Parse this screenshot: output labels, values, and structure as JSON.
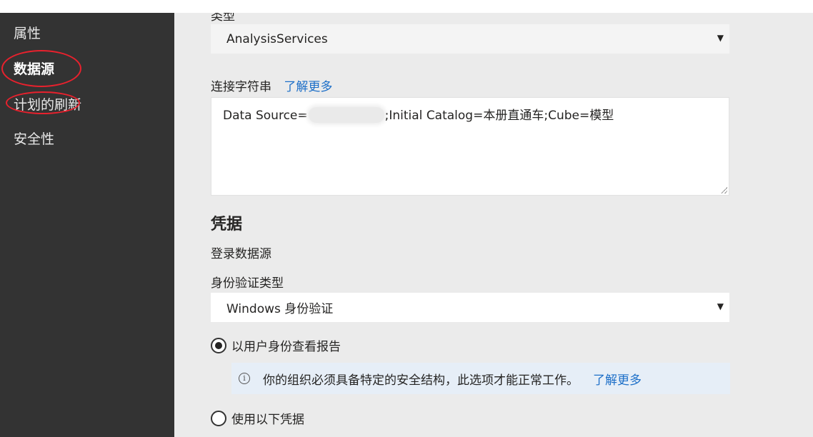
{
  "sidebar": {
    "items": [
      {
        "label": "属性",
        "active": false
      },
      {
        "label": "数据源",
        "active": true
      },
      {
        "label": "计划的刷新",
        "active": false
      },
      {
        "label": "安全性",
        "active": false
      }
    ]
  },
  "connection": {
    "type_label_partial": "类型",
    "type_value": "AnalysisServices",
    "string_label": "连接字符串",
    "learn_more": "了解更多",
    "string_prefix": "Data Source=",
    "string_suffix": ";Initial Catalog=本册直通车;Cube=模型"
  },
  "credentials": {
    "title": "凭据",
    "subtitle": "登录数据源",
    "auth_label": "身份验证类型",
    "auth_value": "Windows 身份验证",
    "option1": "以用户身份查看报告",
    "info_text": "你的组织必须具备特定的安全结构，此选项才能正常工作。",
    "info_link": "了解更多",
    "option2": "使用以下凭据"
  },
  "colors": {
    "sidebar_bg": "#333333",
    "accent_link": "#1d6fc8",
    "annotation_red": "#e8212d"
  }
}
